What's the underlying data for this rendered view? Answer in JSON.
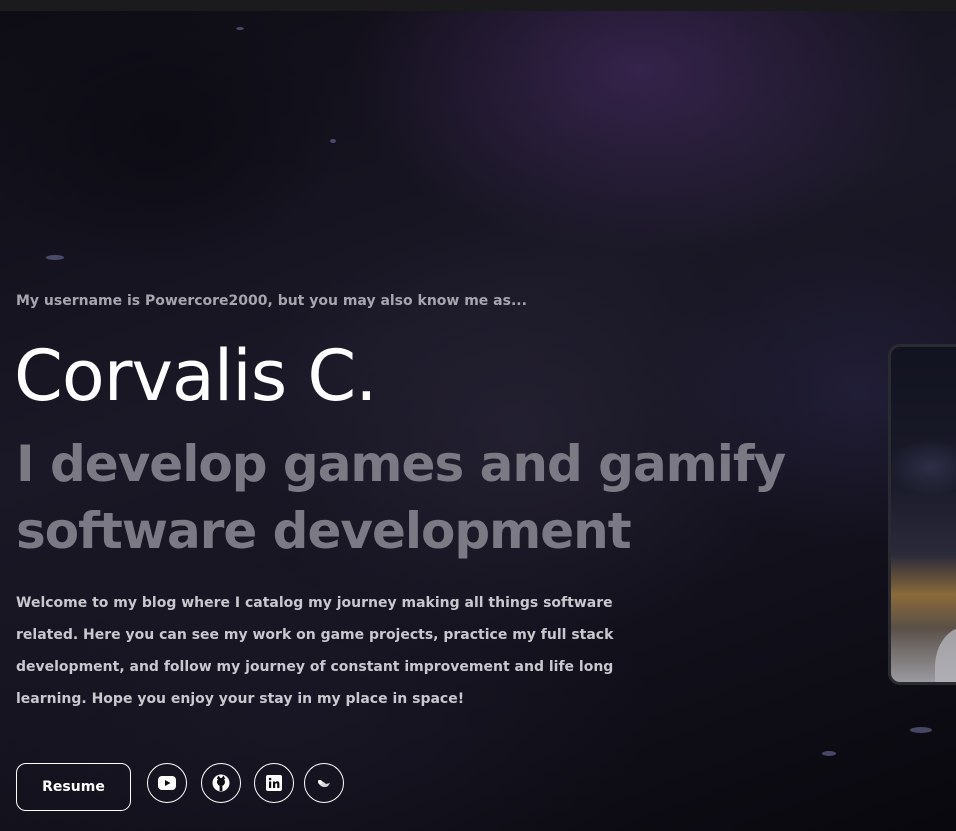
{
  "hero": {
    "intro": "My username is Powercore2000, but you may also know me as...",
    "name": "Corvalis C.",
    "tagline": "I develop games and gamify software development",
    "blurb": "Welcome to my blog where I catalog my journey making all things software related. Here you can see my work on game projects, practice my full stack development, and follow my journey of constant improvement and life long learning. Hope you enjoy your stay in my place in space!"
  },
  "actions": {
    "resume_label": "Resume",
    "socials": [
      {
        "icon": "youtube-icon"
      },
      {
        "icon": "github-icon"
      },
      {
        "icon": "linkedin-icon"
      },
      {
        "icon": "bird-icon"
      }
    ]
  },
  "colors": {
    "background": "#07060c",
    "name_text": "#ffffff",
    "tagline_text": "#7b7a84",
    "body_text": "#c9c8ce",
    "button_border": "#ffffff"
  }
}
